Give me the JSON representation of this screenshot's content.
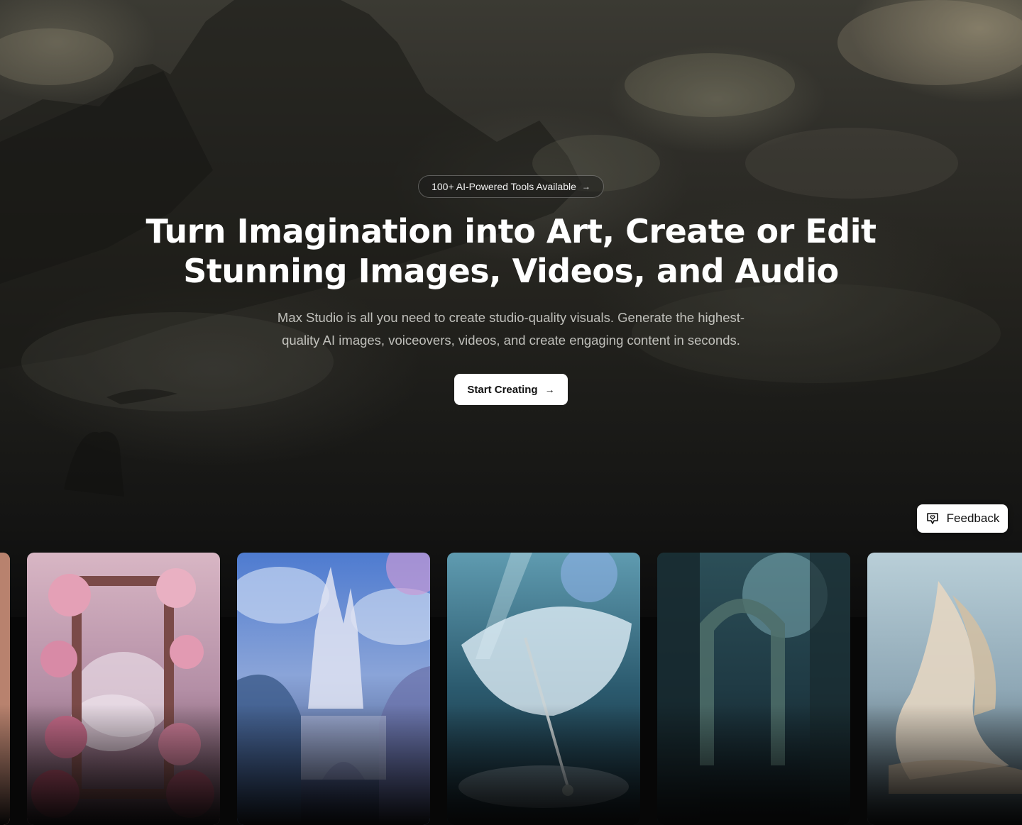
{
  "hero": {
    "badge_label": "100+ AI-Powered Tools Available",
    "badge_icon": "arrow-right-icon",
    "headline_line1": "Turn Imagination into Art, Create or Edit",
    "headline_line2": "Stunning Images, Videos, and Audio",
    "subtext_line1": "Max Studio is all you need to create studio-quality visuals. Generate the highest-",
    "subtext_line2": "quality AI images, voiceovers, videos, and create engaging content in seconds.",
    "cta_label": "Start Creating",
    "cta_icon": "arrow-right-icon"
  },
  "feedback": {
    "label": "Feedback",
    "icon": "heart-chat-icon"
  },
  "gallery": {
    "cards": [
      {
        "subject": "partial-card"
      },
      {
        "subject": "flower-framed-mirror"
      },
      {
        "subject": "sky-castle"
      },
      {
        "subject": "crystal-umbrella"
      },
      {
        "subject": "forest-archway"
      },
      {
        "subject": "shell-ship"
      }
    ]
  },
  "colors": {
    "background": "#070707",
    "button_bg": "#ffffff",
    "button_text": "#111111"
  }
}
